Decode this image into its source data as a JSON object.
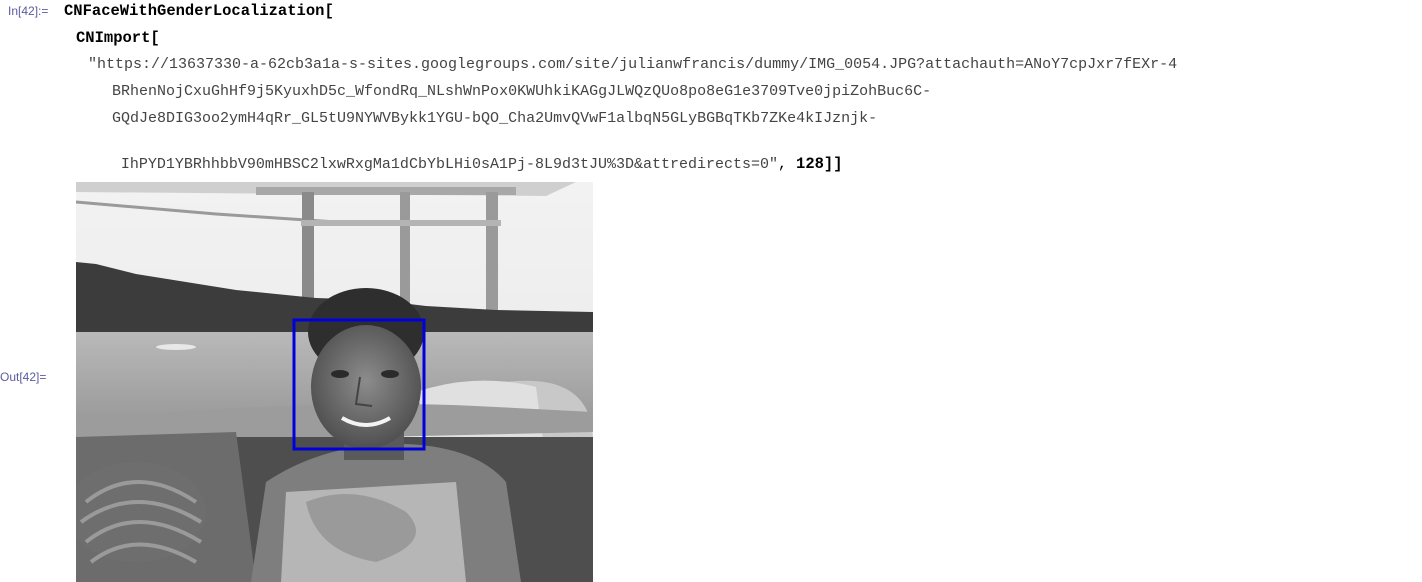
{
  "input_cell": {
    "label": "In[42]:=",
    "function": "CNFaceWithGenderLocalization[",
    "import_call": "CNImport[",
    "url_lines": [
      "\"https://13637330-a-62cb3a1a-s-sites.googlegroups.com/site/julianwfrancis/dummy/IMG_0054.JPG?attachauth=ANoY7cpJxr7fEXr-4",
      "BRhenNojCxuGhHf9j5KyuxhD5c_WfondRq_NLshWnPox0KWUhkiKAGgJLWQzQUo8po8eG1e3709Tve0jpiZohBuc6C-",
      "GQdJe8DIG3oo2ymH4qRr_GL5tU9NYWVBykk1YGU-bQO_Cha2UmvQVwF1albqN5GLyBGBqTKb7ZKe4kIJznjk-",
      "IhPYD1YBRhhbbV90mHBSC2lxwRxgMa1dCbYbLHi0sA1Pj-8L9d3tJU%3D&attredirects=0\""
    ],
    "separator": ", ",
    "size_arg": "128",
    "closing": "]]"
  },
  "output_cell": {
    "label": "Out[42]=",
    "box_color": "#0000dd"
  }
}
